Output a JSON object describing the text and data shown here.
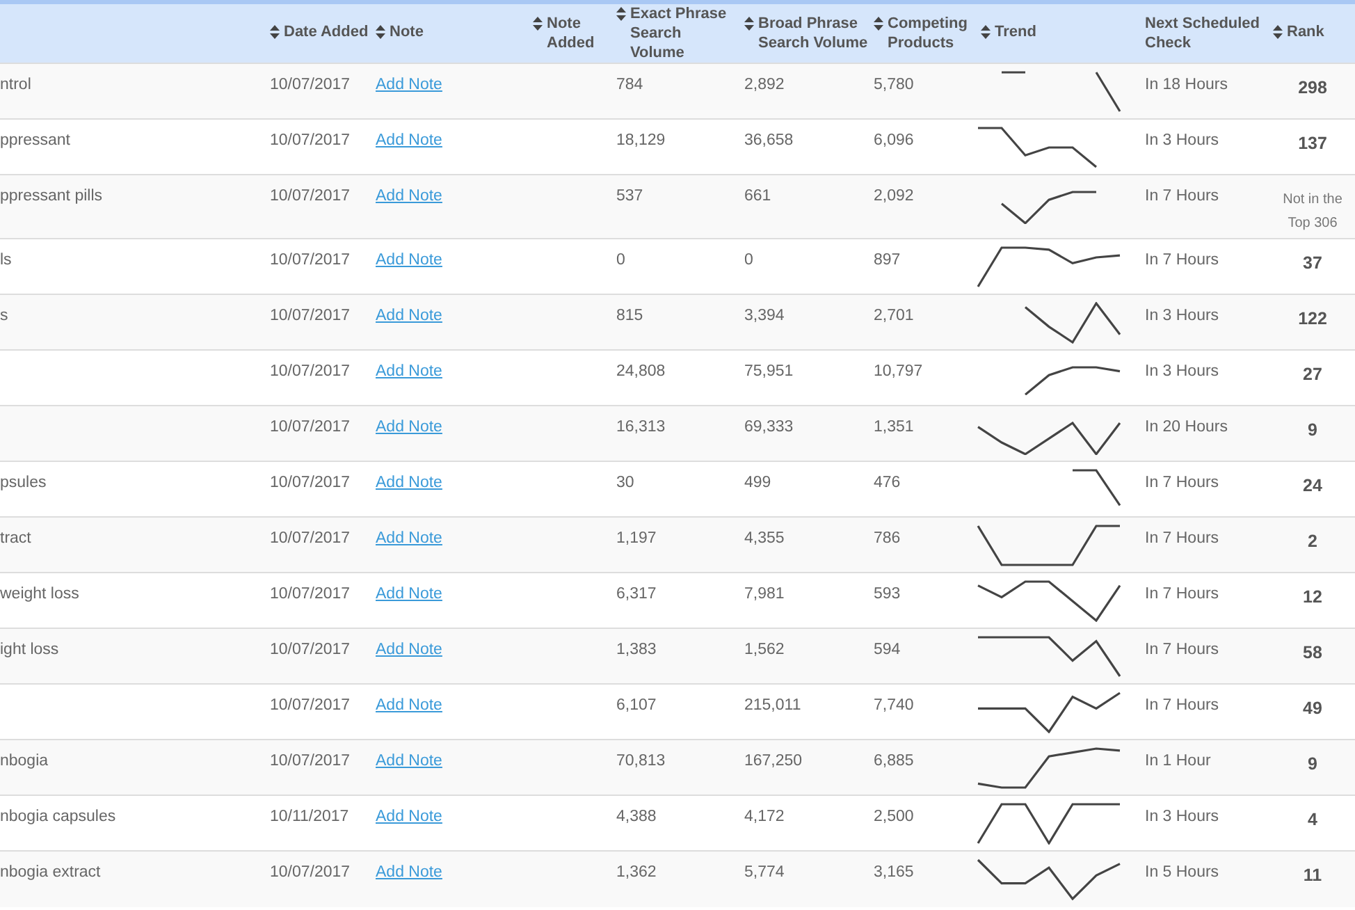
{
  "table": {
    "columns": [
      {
        "label": "Date Added",
        "sortable": true
      },
      {
        "label": "Note",
        "sortable": true
      },
      {
        "label": "Note Added",
        "sortable": true
      },
      {
        "label": "Exact Phrase Search Volume",
        "sortable": true
      },
      {
        "label": "Broad Phrase Search Volume",
        "sortable": true
      },
      {
        "label": "Competing Products",
        "sortable": true
      },
      {
        "label": "Trend",
        "sortable": true
      },
      {
        "label": "Next Scheduled Check",
        "sortable": false
      },
      {
        "label": "Rank",
        "sortable": true
      }
    ],
    "rows": [
      {
        "column_1": "ntrol",
        "date_added": "10/07/2017",
        "note": "Add Note",
        "exact": "784",
        "broad": "2,892",
        "competing": "5,780",
        "next_check": "In 18 Hours",
        "rank": {
          "text": "298",
          "kind": "number"
        }
      },
      {
        "column_1": "ppressant",
        "date_added": "10/07/2017",
        "note": "Add Note",
        "exact": "18,129",
        "broad": "36,658",
        "competing": "6,096",
        "next_check": "In 3 Hours",
        "rank": {
          "text": "137",
          "kind": "number"
        }
      },
      {
        "column_1": "ppressant pills",
        "date_added": "10/07/2017",
        "note": "Add Note",
        "exact": "537",
        "broad": "661",
        "competing": "2,092",
        "next_check": "In 7 Hours",
        "rank": {
          "text": "Not in the Top 306",
          "kind": "unranked"
        }
      },
      {
        "column_1": "ls",
        "date_added": "10/07/2017",
        "note": "Add Note",
        "exact": "0",
        "broad": "0",
        "competing": "897",
        "next_check": "In 7 Hours",
        "rank": {
          "text": "37",
          "kind": "number"
        }
      },
      {
        "column_1": "s",
        "date_added": "10/07/2017",
        "note": "Add Note",
        "exact": "815",
        "broad": "3,394",
        "competing": "2,701",
        "next_check": "In 3 Hours",
        "rank": {
          "text": "122",
          "kind": "number"
        }
      },
      {
        "date_added": "10/07/2017",
        "note": "Add Note",
        "exact": "24,808",
        "broad": "75,951",
        "competing": "10,797",
        "next_check": "In 3 Hours",
        "rank": {
          "text": "27",
          "kind": "number"
        }
      },
      {
        "date_added": "10/07/2017",
        "note": "Add Note",
        "exact": "16,313",
        "broad": "69,333",
        "competing": "1,351",
        "next_check": "In 20 Hours",
        "rank": {
          "text": "9",
          "kind": "number"
        }
      },
      {
        "column_1": "psules",
        "date_added": "10/07/2017",
        "note": "Add Note",
        "exact": "30",
        "broad": "499",
        "competing": "476",
        "next_check": "In 7 Hours",
        "rank": {
          "text": "24",
          "kind": "number"
        }
      },
      {
        "column_1": "tract",
        "date_added": "10/07/2017",
        "note": "Add Note",
        "exact": "1,197",
        "broad": "4,355",
        "competing": "786",
        "next_check": "In 7 Hours",
        "rank": {
          "text": "2",
          "kind": "number"
        }
      },
      {
        "column_1": "weight loss",
        "date_added": "10/07/2017",
        "note": "Add Note",
        "exact": "6,317",
        "broad": "7,981",
        "competing": "593",
        "next_check": "In 7 Hours",
        "rank": {
          "text": "12",
          "kind": "number"
        }
      },
      {
        "column_1": "ight loss",
        "date_added": "10/07/2017",
        "note": "Add Note",
        "exact": "1,383",
        "broad": "1,562",
        "competing": "594",
        "next_check": "In 7 Hours",
        "rank": {
          "text": "58",
          "kind": "number"
        }
      },
      {
        "date_added": "10/07/2017",
        "note": "Add Note",
        "exact": "6,107",
        "broad": "215,011",
        "competing": "7,740",
        "next_check": "In 7 Hours",
        "rank": {
          "text": "49",
          "kind": "number"
        }
      },
      {
        "column_1": "nbogia",
        "date_added": "10/07/2017",
        "note": "Add Note",
        "exact": "70,813",
        "broad": "167,250",
        "competing": "6,885",
        "next_check": "In 1 Hour",
        "rank": {
          "text": "9",
          "kind": "number"
        }
      },
      {
        "column_1": "nbogia capsules",
        "date_added": "10/11/2017",
        "note": "Add Note",
        "exact": "4,388",
        "broad": "4,172",
        "competing": "2,500",
        "next_check": "In 3 Hours",
        "rank": {
          "text": "4",
          "kind": "number"
        }
      },
      {
        "column_1": "nbogia extract",
        "date_added": "10/07/2017",
        "note": "Add Note",
        "exact": "1,362",
        "broad": "5,774",
        "competing": "3,165",
        "next_check": "In 5 Hours",
        "rank": {
          "text": "11",
          "kind": "number"
        }
      }
    ]
  }
}
